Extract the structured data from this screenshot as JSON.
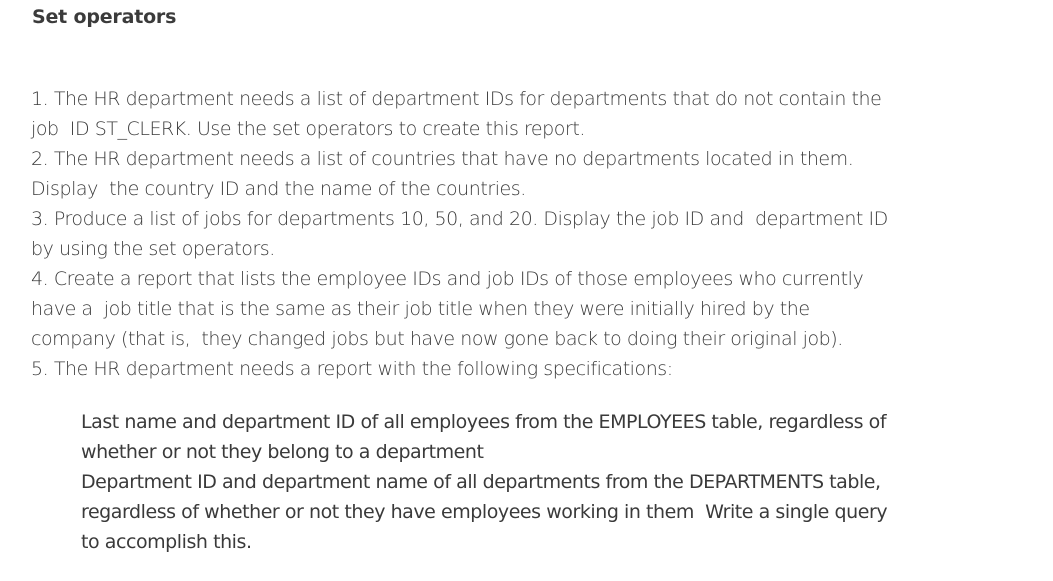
{
  "title": "Set operators",
  "items": [
    {
      "lines": [
        "1. The HR department needs a list of department IDs for departments that do not contain the",
        "job  ID ST_CLERK. Use the set operators to create this report."
      ]
    },
    {
      "lines": [
        "2. The HR department needs a list of countries that have no departments located in them.",
        "Display  the country ID and the name of the countries."
      ]
    },
    {
      "lines": [
        "3. Produce a list of jobs for departments 10, 50, and 20. Display the job ID and  department ID",
        "by using the set operators."
      ]
    },
    {
      "lines": [
        "4. Create a report that lists the employee IDs and job IDs of those employees who currently",
        "have a  job title that is the same as their job title when they were initially hired by the",
        "company (that is,  they changed jobs but have now gone back to doing their original job)."
      ]
    },
    {
      "lines": [
        "5. The HR department needs a report with the following specifications:"
      ]
    }
  ],
  "specifications": [
    "Last name and department ID of all employees from the EMPLOYEES table, regardless of",
    "whether or not they belong to a department",
    "Department ID and department name of all departments from the DEPARTMENTS table,",
    "regardless of whether or not they have employees working in them  Write a single query",
    "to accomplish this."
  ]
}
